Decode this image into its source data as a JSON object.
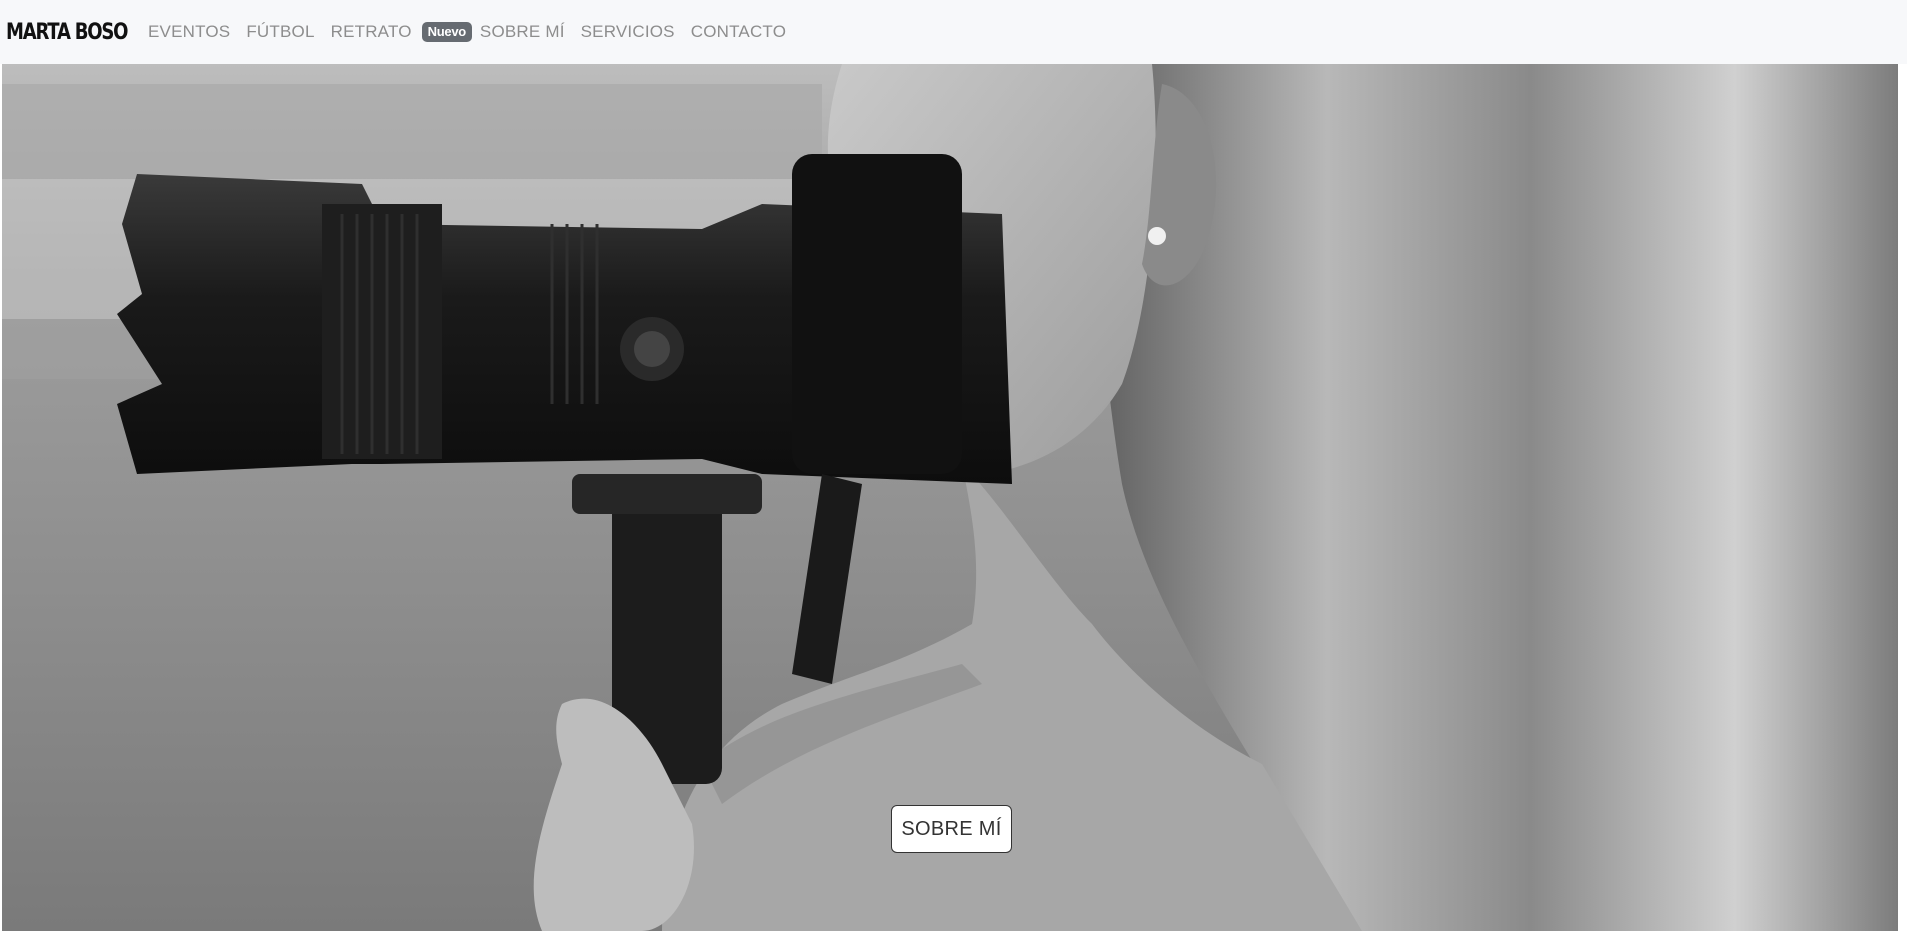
{
  "brand": "MARTA BOSO",
  "nav": {
    "items": [
      {
        "label": "EVENTOS"
      },
      {
        "label": "FÚTBOL"
      },
      {
        "label": "RETRATO"
      },
      {
        "label": "SOBRE MÍ"
      },
      {
        "label": "SERVICIOS"
      },
      {
        "label": "CONTACTO"
      }
    ],
    "badge": "Nuevo"
  },
  "hero": {
    "image": "black-and-white photo of a woman photographer with a telephoto lens camera",
    "button_label": "SOBRE MÍ"
  },
  "colors": {
    "navbar_bg": "#f7f8fa",
    "nav_link": "#8d8d8d",
    "badge_bg": "#666b71"
  }
}
